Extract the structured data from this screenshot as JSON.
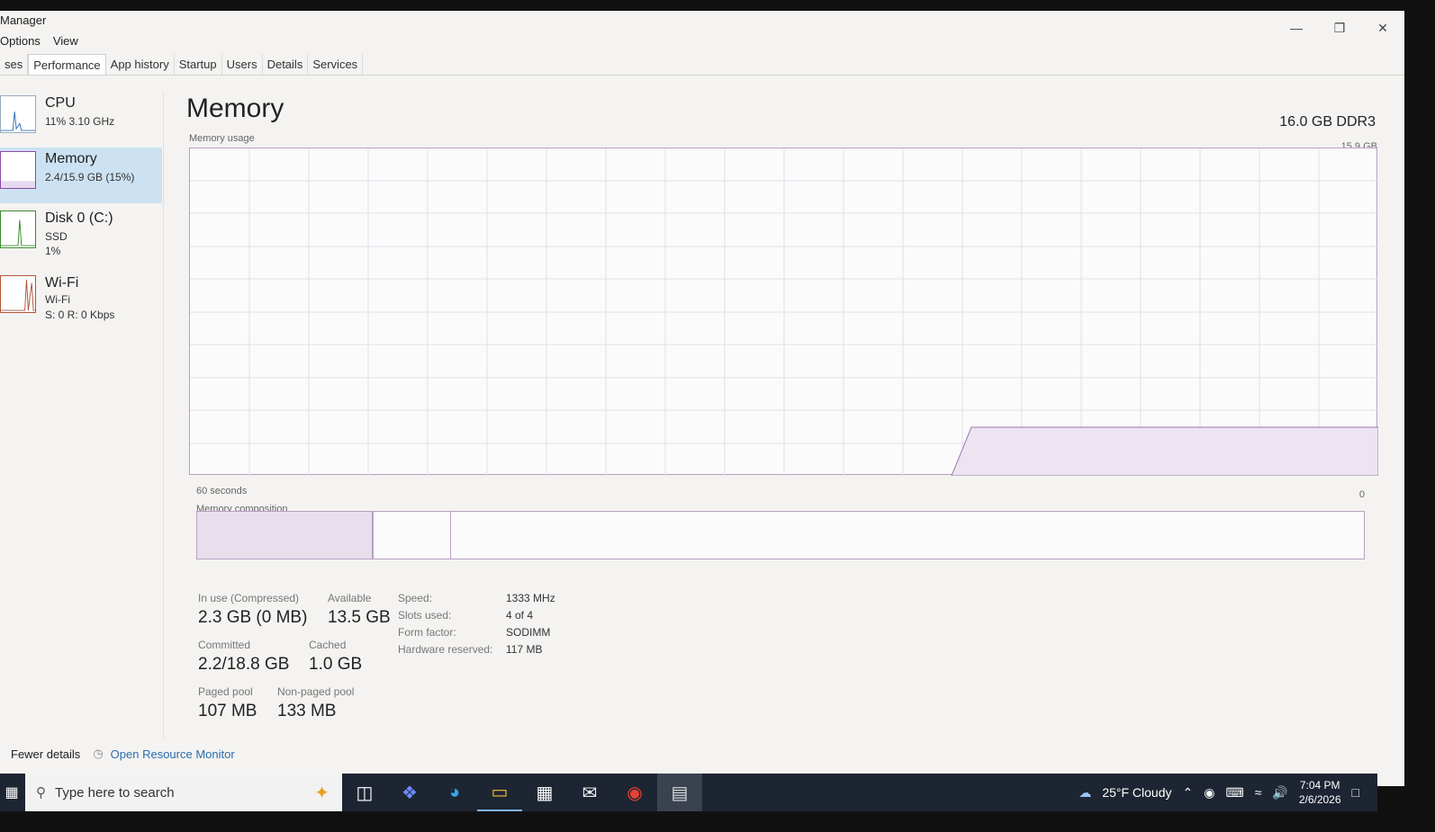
{
  "window": {
    "title": "Manager",
    "menu": [
      "Options",
      "View"
    ],
    "tabs": [
      "ses",
      "Performance",
      "App history",
      "Startup",
      "Users",
      "Details",
      "Services"
    ],
    "active_tab": "Performance"
  },
  "sidebar": {
    "items": [
      {
        "name": "CPU",
        "sub1": "11%  3.10 GHz",
        "sub2": "",
        "color": "#2f6fb3",
        "active": false
      },
      {
        "name": "Memory",
        "sub1": "2.4/15.9 GB (15%)",
        "sub2": "",
        "color": "#8b4aa8",
        "active": true
      },
      {
        "name": "Disk 0 (C:)",
        "sub1": "SSD",
        "sub2": "1%",
        "color": "#3a8a2e",
        "active": false
      },
      {
        "name": "Wi-Fi",
        "sub1": "Wi-Fi",
        "sub2": "S: 0  R: 0 Kbps",
        "color": "#b0553a",
        "active": false
      }
    ]
  },
  "main": {
    "heading": "Memory",
    "spec": "16.0 GB DDR3",
    "usage_label": "Memory usage",
    "max_label": "15.9 GB",
    "time_label": "60 seconds",
    "zero_label": "0",
    "composition_label": "Memory composition",
    "stats": {
      "in_use_label": "In use (Compressed)",
      "in_use_value": "2.3 GB (0 MB)",
      "available_label": "Available",
      "available_value": "13.5 GB",
      "committed_label": "Committed",
      "committed_value": "2.2/18.8 GB",
      "cached_label": "Cached",
      "cached_value": "1.0 GB",
      "paged_label": "Paged pool",
      "paged_value": "107 MB",
      "nonpaged_label": "Non-paged pool",
      "nonpaged_value": "133 MB"
    },
    "details": [
      {
        "label": "Speed:",
        "value": "1333 MHz"
      },
      {
        "label": "Slots used:",
        "value": "4 of 4"
      },
      {
        "label": "Form factor:",
        "value": "SODIMM"
      },
      {
        "label": "Hardware reserved:",
        "value": "117 MB"
      }
    ]
  },
  "footer": {
    "fewer_details": "Fewer details",
    "open_monitor": "Open Resource Monitor"
  },
  "taskbar": {
    "search_placeholder": "Type here to search",
    "weather": "25°F  Cloudy",
    "time": "7:04 PM",
    "date": "2/6/2026"
  }
}
